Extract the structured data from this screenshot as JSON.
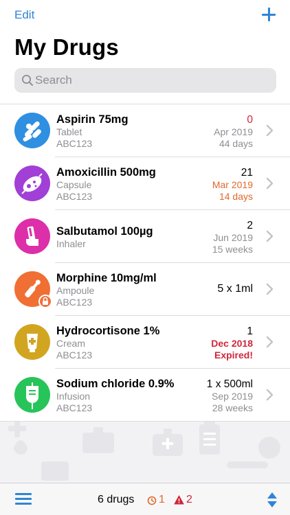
{
  "header": {
    "edit_label": "Edit",
    "title": "My Drugs"
  },
  "search": {
    "placeholder": "Search",
    "value": ""
  },
  "drugs": [
    {
      "name": "Aspirin 75mg",
      "form": "Tablet",
      "batch": "ABC123",
      "quantity": "0",
      "expiry": "Apr 2019",
      "remaining": "44 days",
      "icon": "pills-icon",
      "color": "#2f8fe0"
    },
    {
      "name": "Amoxicillin 500mg",
      "form": "Capsule",
      "batch": "ABC123",
      "quantity": "21",
      "expiry": "Mar 2019",
      "remaining": "14 days",
      "icon": "capsule-bacteria-icon",
      "color": "#a13fd6"
    },
    {
      "name": "Salbutamol 100µg",
      "form": "Inhaler",
      "quantity": "2",
      "expiry": "Jun 2019",
      "remaining": "15 weeks",
      "icon": "inhaler-icon",
      "color": "#dc2fa9"
    },
    {
      "name": "Morphine 10mg/ml",
      "form": "Ampoule",
      "batch": "ABC123",
      "quantity": "5 x 1ml",
      "icon": "ampoule-icon",
      "badge_icon": "lock-icon",
      "color": "#ef6f34"
    },
    {
      "name": "Hydrocortisone 1%",
      "form": "Cream",
      "batch": "ABC123",
      "quantity": "1",
      "expiry": "Dec 2018",
      "remaining": "Expired!",
      "icon": "cream-tube-icon",
      "color": "#d2a521"
    },
    {
      "name": "Sodium chloride 0.9%",
      "form": "Infusion",
      "batch": "ABC123",
      "quantity": "1 x 500ml",
      "expiry": "Sep 2019",
      "remaining": "28 weeks",
      "icon": "iv-bag-icon",
      "color": "#27c45a"
    }
  ],
  "footer": {
    "count": "6 drugs",
    "expiring_soon": "1",
    "expired": "2"
  },
  "colors": {
    "accent": "#2f84d6",
    "warning": "#e0692b",
    "danger": "#d0263a"
  }
}
